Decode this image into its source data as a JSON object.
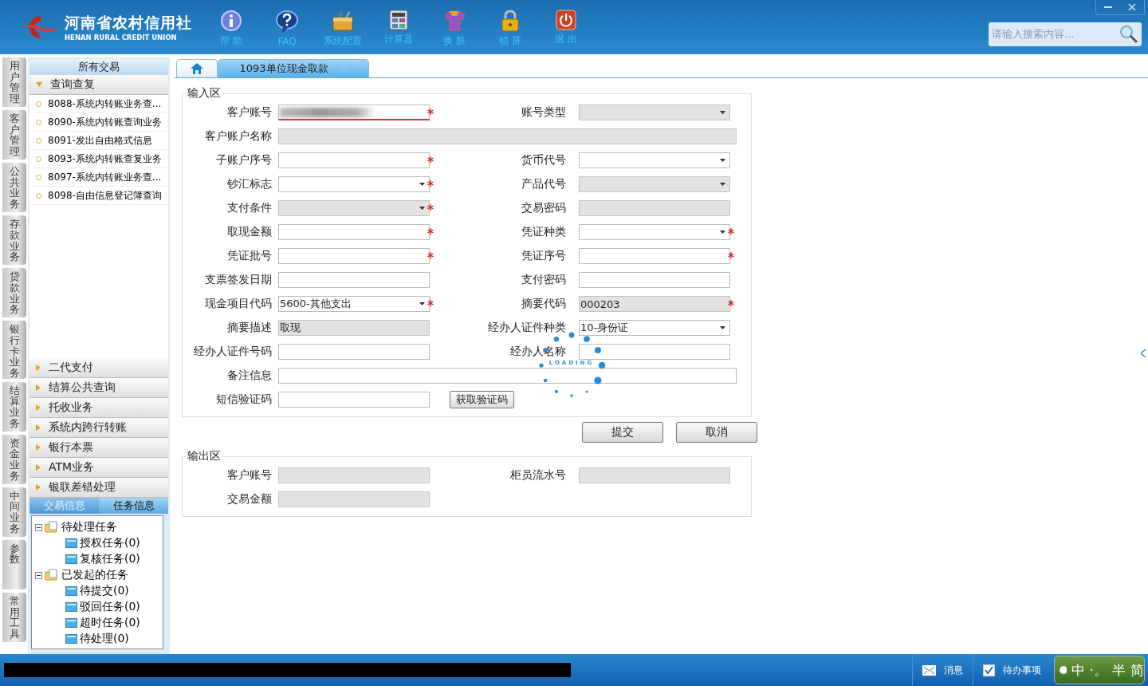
{
  "header": {
    "logo_title": "河南省农村信用社",
    "logo_subtitle": "HENAN RURAL CREDIT UNION",
    "toolbar": [
      {
        "label": "帮 助",
        "kind": "info"
      },
      {
        "label": "FAQ",
        "kind": "question"
      },
      {
        "label": "系统配置",
        "kind": "toolbox"
      },
      {
        "label": "计算器",
        "kind": "calculator"
      },
      {
        "label": "换 肤",
        "kind": "shirt"
      },
      {
        "label": "锁 屏",
        "kind": "lock"
      },
      {
        "label": "退 出",
        "kind": "power"
      }
    ],
    "search": {
      "placeholder": "请输入搜索内容..."
    }
  },
  "side_tabs": [
    "用户管理",
    "客户管理",
    "公共业务",
    "存款业务",
    "贷款业务",
    "银行卡业务",
    "结算业务",
    "资金业务",
    "中间业务",
    "参数",
    "常用工具"
  ],
  "nav_panel": {
    "title": "所有交易",
    "groups": [
      {
        "label": "查询查复",
        "expanded": true,
        "items": [
          "8088-系统内转账业务查...",
          "8090-系统内转账查询业务",
          "8091-发出自由格式信息",
          "8093-系统内转账查复业务",
          "8097-系统内转账业务查...",
          "8098-自由信息登记簿查询"
        ]
      },
      {
        "label": "二代支付",
        "expanded": false
      },
      {
        "label": "结算公共查询",
        "expanded": false
      },
      {
        "label": "托收业务",
        "expanded": false
      },
      {
        "label": "系统内跨行转账",
        "expanded": false
      },
      {
        "label": "银行本票",
        "expanded": false
      },
      {
        "label": "ATM业务",
        "expanded": false
      },
      {
        "label": "银联差错处理",
        "expanded": false
      }
    ]
  },
  "info_tabs": [
    {
      "label": "交易信息",
      "selected": false
    },
    {
      "label": "任务信息",
      "selected": true
    }
  ],
  "task_tree": [
    {
      "label": "待处理任务",
      "expanded": true,
      "children": [
        {
          "label": "授权任务(0)"
        },
        {
          "label": "复核任务(0)"
        }
      ]
    },
    {
      "label": "已发起的任务",
      "expanded": true,
      "children": [
        {
          "label": "待提交(0)"
        },
        {
          "label": "驳回任务(0)"
        },
        {
          "label": "超时任务(0)"
        },
        {
          "label": "待处理(0)"
        }
      ]
    }
  ],
  "tabs": [
    {
      "kind": "home",
      "selected": false
    },
    {
      "kind": "page",
      "label": "1093单位现金取款",
      "selected": true
    }
  ],
  "input_area": {
    "title": "输入区",
    "rows": [
      [
        {
          "label": "客户账号",
          "kind": "text",
          "required": true,
          "disabled": false,
          "blurred": true,
          "error": true
        },
        {
          "label": "账号类型",
          "kind": "select",
          "required": false,
          "disabled": true
        }
      ],
      [
        {
          "label": "客户账户名称",
          "kind": "wide",
          "required": false,
          "disabled": true
        }
      ],
      [
        {
          "label": "子账户序号",
          "kind": "text",
          "required": true,
          "disabled": false
        },
        {
          "label": "货币代号",
          "kind": "select",
          "required": false,
          "disabled": false
        }
      ],
      [
        {
          "label": "钞汇标志",
          "kind": "select",
          "required": true,
          "disabled": false
        },
        {
          "label": "产品代号",
          "kind": "select",
          "required": false,
          "disabled": true
        }
      ],
      [
        {
          "label": "支付条件",
          "kind": "select",
          "required": true,
          "disabled": true
        },
        {
          "label": "交易密码",
          "kind": "text",
          "required": false,
          "disabled": true
        }
      ],
      [
        {
          "label": "取现金额",
          "kind": "text",
          "required": true,
          "disabled": false
        },
        {
          "label": "凭证种类",
          "kind": "select",
          "required": true,
          "disabled": false
        }
      ],
      [
        {
          "label": "凭证批号",
          "kind": "text",
          "required": true,
          "disabled": false
        },
        {
          "label": "凭证序号",
          "kind": "text",
          "required": true,
          "disabled": false
        }
      ],
      [
        {
          "label": "支票签发日期",
          "kind": "text",
          "required": false,
          "disabled": false
        },
        {
          "label": "支付密码",
          "kind": "text",
          "required": false,
          "disabled": false
        }
      ],
      [
        {
          "label": "现金项目代码",
          "kind": "select",
          "value": "5600-其他支出",
          "required": true,
          "disabled": false
        },
        {
          "label": "摘要代码",
          "kind": "text",
          "value": "000203",
          "required": true,
          "disabled": true
        }
      ],
      [
        {
          "label": "摘要描述",
          "kind": "text",
          "value": "取现",
          "required": false,
          "disabled": true
        },
        {
          "label": "经办人证件种类",
          "kind": "select",
          "value": "10-身份证",
          "required": false,
          "disabled": false
        }
      ],
      [
        {
          "label": "经办人证件号码",
          "kind": "text",
          "required": false,
          "disabled": false
        },
        {
          "label": "经办人名称",
          "kind": "text",
          "required": false,
          "disabled": false
        }
      ],
      [
        {
          "label": "备注信息",
          "kind": "wide",
          "required": false,
          "disabled": false
        }
      ],
      [
        {
          "label": "短信验证码",
          "kind": "text",
          "required": false,
          "disabled": false,
          "button": "获取验证码"
        }
      ]
    ]
  },
  "loading": {
    "label": "LOADING"
  },
  "actions": [
    "提交",
    "取消"
  ],
  "output_area": {
    "title": "输出区",
    "rows": [
      [
        {
          "label": "客户账号",
          "kind": "text",
          "required": false,
          "disabled": true
        },
        {
          "label": "柜员流水号",
          "kind": "text",
          "required": false,
          "disabled": true
        }
      ],
      [
        {
          "label": "交易金额",
          "kind": "text",
          "required": false,
          "disabled": true
        }
      ]
    ]
  },
  "status_bar": {
    "messages": "消息",
    "todo": "待办事项",
    "ime": [
      "中",
      "·。",
      "半",
      "简"
    ]
  }
}
